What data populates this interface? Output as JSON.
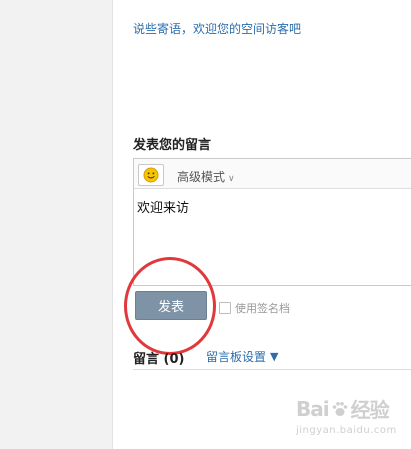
{
  "intro": {
    "link_text": "说些寄语，欢迎您的空间访客吧"
  },
  "compose": {
    "title": "发表您的留言",
    "mode_label": "高级模式",
    "editor_text": "欢迎来访",
    "submit_label": "发表",
    "signature_label": "使用签名档"
  },
  "messages": {
    "title": "留言 (0)",
    "settings_label": "留言板设置",
    "settings_arrow": "▼"
  },
  "watermark": {
    "brand_left": "Bai",
    "brand_right": "经验",
    "url": "jingyan.baidu.com"
  },
  "colors": {
    "link": "#2b6dad",
    "submit_bg": "#7f93a6",
    "highlight": "#e0383b"
  }
}
